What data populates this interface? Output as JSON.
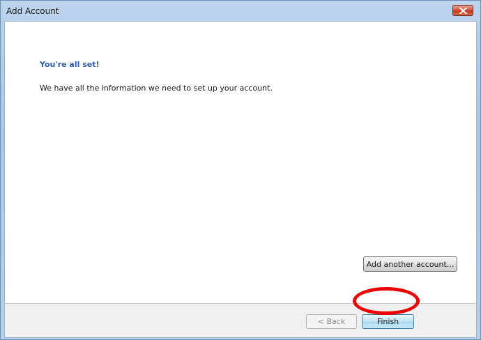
{
  "window": {
    "title": "Add Account"
  },
  "content": {
    "heading": "You're all set!",
    "message": "We have all the information we need to set up your account.",
    "add_another_label": "Add another account..."
  },
  "footer": {
    "back_label": "< Back",
    "finish_label": "Finish"
  },
  "colors": {
    "heading": "#2f5ea3",
    "highlight": "#ee0000"
  }
}
